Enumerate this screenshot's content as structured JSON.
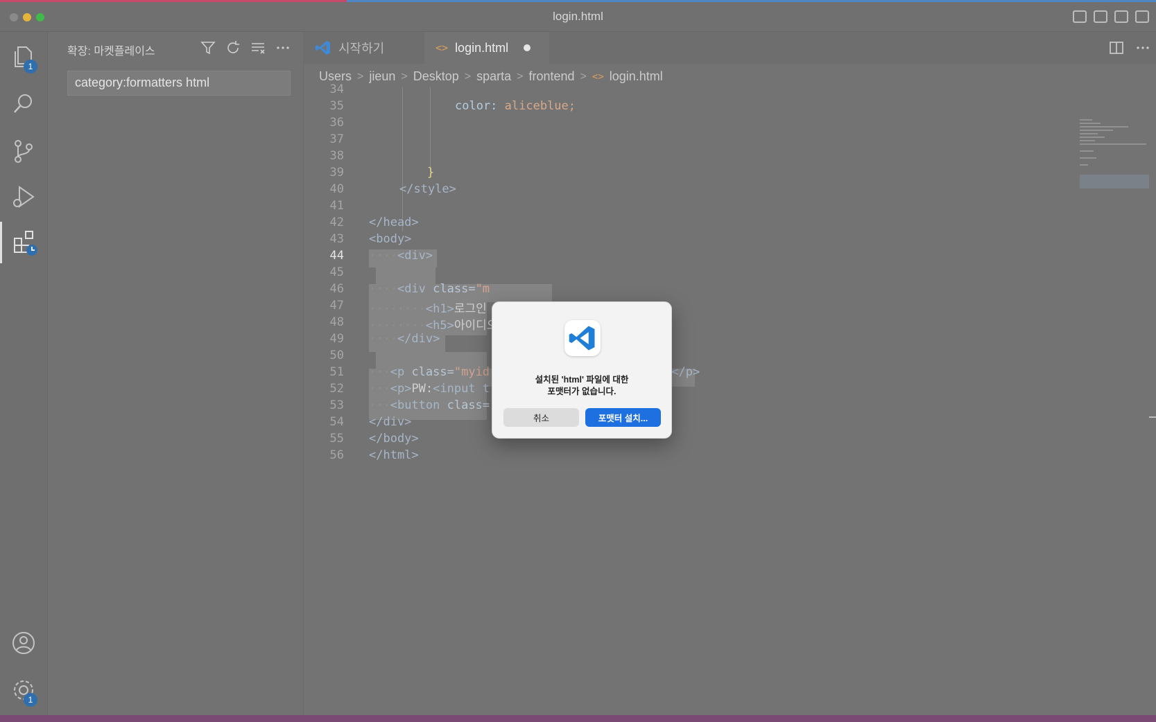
{
  "window": {
    "title": "login.html"
  },
  "activity_bar": {
    "explorer_badge": "1",
    "settings_badge": "1"
  },
  "sidebar": {
    "title": "확장: 마켓플레이스",
    "search_value": "category:formatters html"
  },
  "tabs": [
    {
      "label": "시작하기"
    },
    {
      "label": "login.html",
      "modified": true
    }
  ],
  "breadcrumb": [
    "Users",
    "jieun",
    "Desktop",
    "sparta",
    "frontend",
    "login.html"
  ],
  "code": {
    "current_line": "44",
    "lines": [
      {
        "n": "34"
      },
      {
        "n": "35"
      },
      {
        "n": "36"
      },
      {
        "n": "37"
      },
      {
        "n": "38"
      },
      {
        "n": "39"
      },
      {
        "n": "40"
      },
      {
        "n": "41"
      },
      {
        "n": "42"
      },
      {
        "n": "43"
      },
      {
        "n": "44"
      },
      {
        "n": "45"
      },
      {
        "n": "46"
      },
      {
        "n": "47"
      },
      {
        "n": "48"
      },
      {
        "n": "49"
      },
      {
        "n": "50"
      },
      {
        "n": "51"
      },
      {
        "n": "52"
      },
      {
        "n": "53"
      },
      {
        "n": "54"
      },
      {
        "n": "55"
      },
      {
        "n": "56"
      }
    ],
    "tokens": {
      "l35_prop": "color:",
      "l35_val": " aliceblue;",
      "l39_brace": "}",
      "l40": "</style>",
      "l42": "</head>",
      "l43": "<body>",
      "l44": "<div>",
      "l46_open": "<div ",
      "l46_attr": "class=",
      "l46_str": "\"m",
      "l47_tag": "<h1>",
      "l47_text": "로그인",
      "l48_tag": "<h5>",
      "l48_text": "아이디오",
      "l49": "</div>",
      "l51_open": "<p ",
      "l51_attr": "class=",
      "l51_str": "\"myid",
      "l51_end": "></p>",
      "l52_open": "<p>",
      "l52_text": "PW:",
      "l52_tag": "<input t",
      "l53_tag": "<button ",
      "l53_attr": "class=",
      "l54": "</div>",
      "l55": "</body>",
      "l56": "</html>"
    }
  },
  "dialog": {
    "message_line1": "설치된 'html' 파일에 대한",
    "message_line2": "포맷터가 없습니다.",
    "cancel_label": "취소",
    "confirm_label": "포맷터 설치..."
  }
}
